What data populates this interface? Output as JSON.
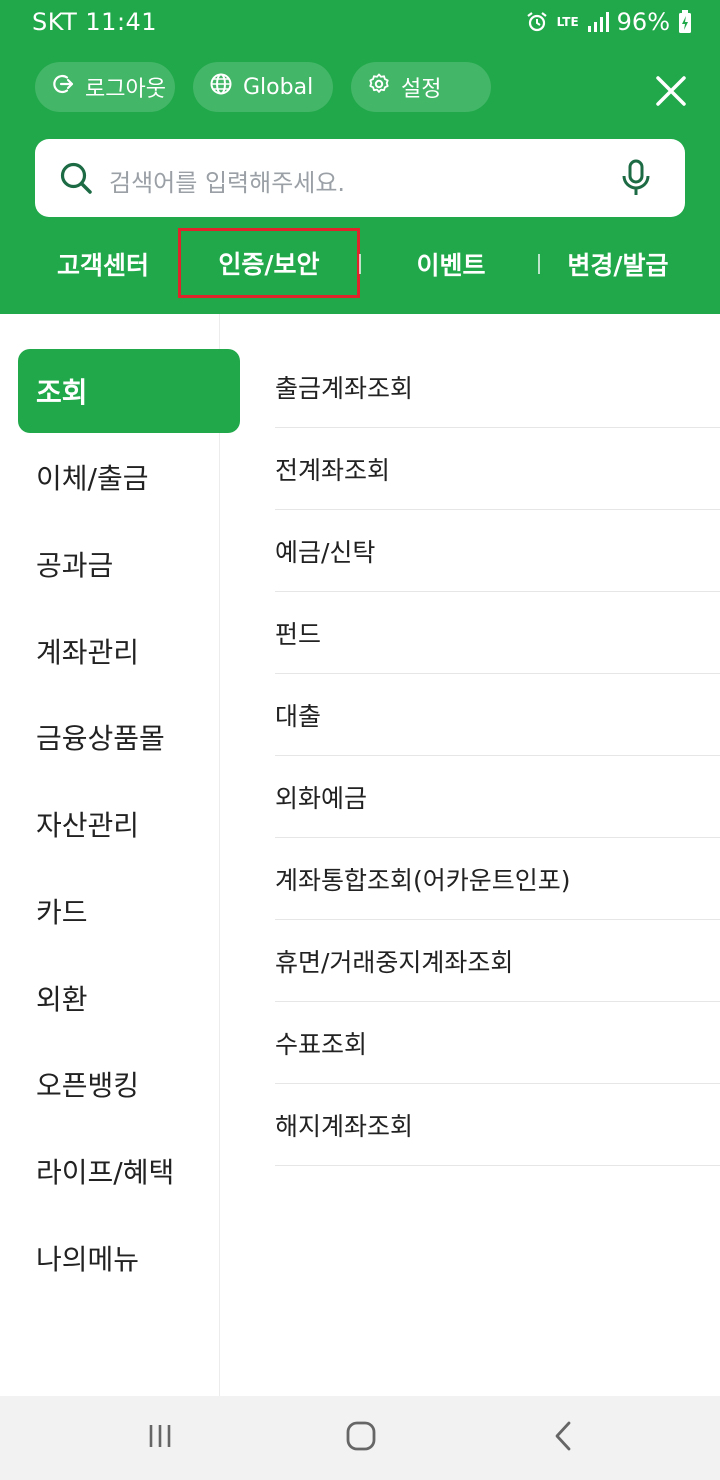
{
  "status_bar": {
    "carrier_time": "SKT 11:41",
    "network": "LTE",
    "battery": "96%"
  },
  "header": {
    "logout_label": "로그아웃",
    "global_label": "Global",
    "settings_label": "설정"
  },
  "search": {
    "placeholder": "검색어를 입력해주세요."
  },
  "quick_tabs": [
    "고객센터",
    "인증/보안",
    "이벤트",
    "변경/발급"
  ],
  "left_nav": [
    "조회",
    "이체/출금",
    "공과금",
    "계좌관리",
    "금융상품몰",
    "자산관리",
    "카드",
    "외환",
    "오픈뱅킹",
    "라이프/혜택",
    "나의메뉴"
  ],
  "right_list": [
    "출금계좌조회",
    "전계좌조회",
    "예금/신탁",
    "펀드",
    "대출",
    "외화예금",
    "계좌통합조회(어카운트인포)",
    "휴면/거래중지계좌조회",
    "수표조회",
    "해지계좌조회"
  ],
  "colors": {
    "brand_green": "#20a84a",
    "highlight_red": "#e0242b"
  },
  "icons": {
    "logout": "logout-icon",
    "global": "globe-icon",
    "settings": "gear-icon",
    "close": "close-icon",
    "search": "search-icon",
    "mic": "mic-icon"
  }
}
